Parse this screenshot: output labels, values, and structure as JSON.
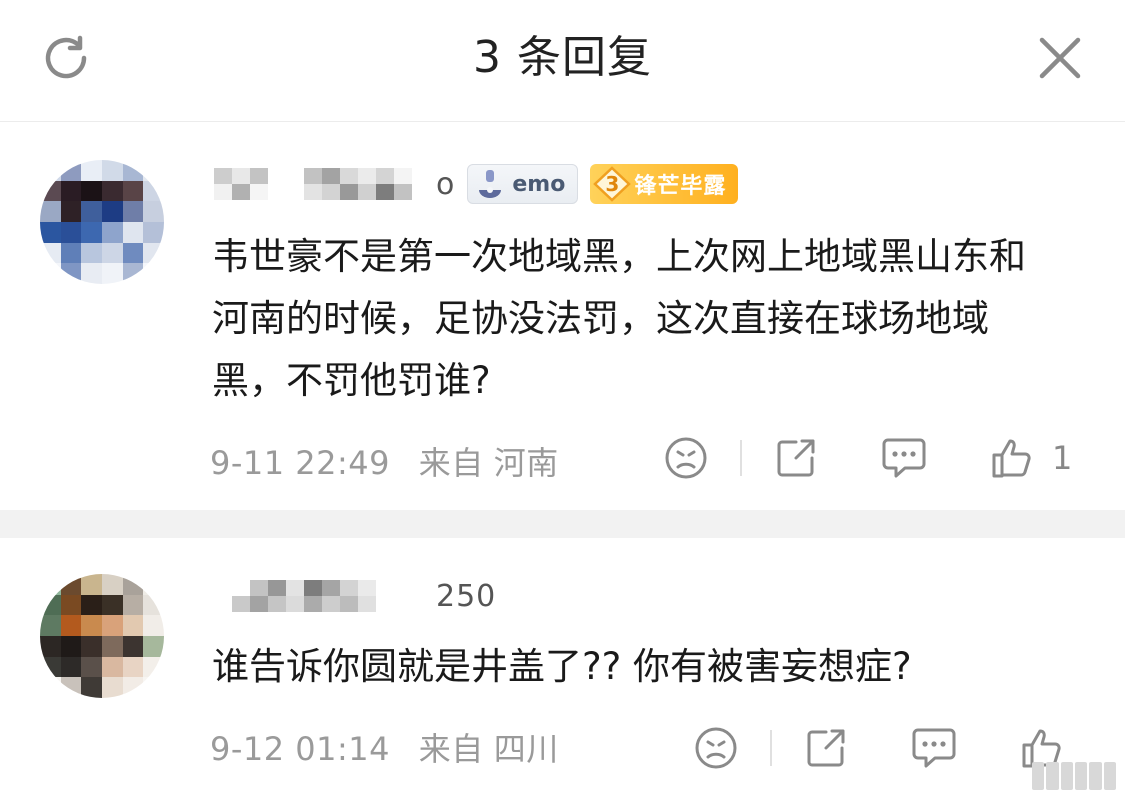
{
  "header": {
    "title": "3 条回复",
    "refresh_icon": "refresh-icon",
    "close_icon": "close-icon"
  },
  "comments": [
    {
      "username_suffix": "o",
      "badges": [
        {
          "type": "emo",
          "label": "emo",
          "icon": "emo-icon"
        },
        {
          "type": "fan",
          "level": "3",
          "label": "锋芒毕露"
        }
      ],
      "content": "韦世豪不是第一次地域黑，上次网上地域黑山东和河南的时候，足协没法罚，这次直接在球场地域黑，不罚他罚谁?",
      "time": "9-11 22:49",
      "source_prefix": "来自",
      "location": "河南",
      "likes": "1",
      "avatar_colors": [
        "#cfd8e8",
        "#8e9bbf",
        "#e9eef6",
        "#d1dae8",
        "#a8b7d3",
        "#e3e8f0",
        "#5b4a52",
        "#2a1c24",
        "#1b1216",
        "#3a2a30",
        "#594447",
        "#cdd5e4",
        "#9aa8c4",
        "#2e2126",
        "#3f5f9c",
        "#1d3c84",
        "#6f7ea8",
        "#c7cfdf",
        "#2b56a0",
        "#2a4f98",
        "#3d68b0",
        "#8ea4cc",
        "#dfe5ef",
        "#b4c0d8",
        "#e6ebf3",
        "#5f7fb8",
        "#b8c6de",
        "#cdd6e6",
        "#6f8bbf",
        "#e1e6ef",
        "#f4f6fa",
        "#7f96c4",
        "#e8ecf3",
        "#f0f3f8",
        "#a9b7d3",
        "#f5f7fb"
      ]
    },
    {
      "username_suffix": "250",
      "content": "谁告诉你圆就是井盖了?? 你有被害妄想症?",
      "time": "9-12 01:14",
      "source_prefix": "来自",
      "location": "四川",
      "likes": "",
      "avatar_colors": [
        "#8fb59a",
        "#6b4a2e",
        "#c9b58e",
        "#d8d0c4",
        "#a9a29a",
        "#efece6",
        "#4f6d55",
        "#7a4a22",
        "#2a1f18",
        "#3a3026",
        "#b7aea4",
        "#e6e2dc",
        "#5e7a62",
        "#b35a1e",
        "#c98a4e",
        "#d9a27a",
        "#e2c9b0",
        "#f1ede8",
        "#2c2724",
        "#1f1a18",
        "#3a2f2a",
        "#7e6a5c",
        "#3c3430",
        "#a6b89c",
        "#3a3a36",
        "#2d2a28",
        "#5a504a",
        "#d9b8a0",
        "#e8d4c4",
        "#f3efea",
        "#f6f4f1",
        "#c9c2bb",
        "#3f3a36",
        "#e8dcd0",
        "#f2ece6",
        "#f7f5f2"
      ]
    }
  ]
}
